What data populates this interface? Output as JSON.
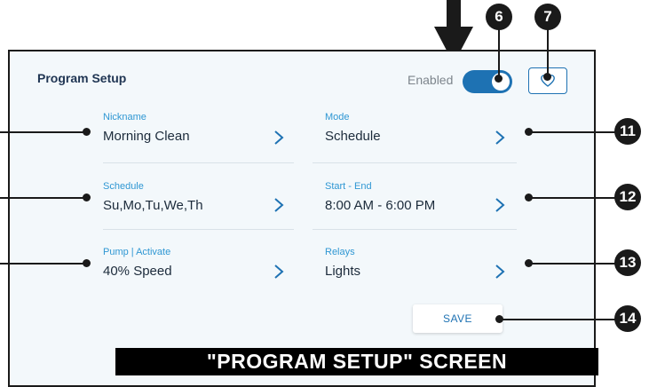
{
  "screen": {
    "title": "Program Setup",
    "enabled_label": "Enabled",
    "enabled": true
  },
  "fields": [
    {
      "label": "Nickname",
      "value": "Morning Clean"
    },
    {
      "label": "Mode",
      "value": "Schedule"
    },
    {
      "label": "Schedule",
      "value": "Su,Mo,Tu,We,Th"
    },
    {
      "label": "Start - End",
      "value": "8:00 AM - 6:00 PM"
    },
    {
      "label": "Pump  |  Activate",
      "value": "40% Speed"
    },
    {
      "label": "Relays",
      "value": "Lights"
    }
  ],
  "save_label": "SAVE",
  "callouts": [
    "6",
    "7",
    "11",
    "12",
    "13",
    "14"
  ],
  "caption": "\"PROGRAM SETUP\" SCREEN",
  "colors": {
    "accent": "#1e72b3",
    "label_blue": "#2f97d3",
    "panel_bg": "#f3f8fb",
    "callout": "#1a1a1a"
  }
}
